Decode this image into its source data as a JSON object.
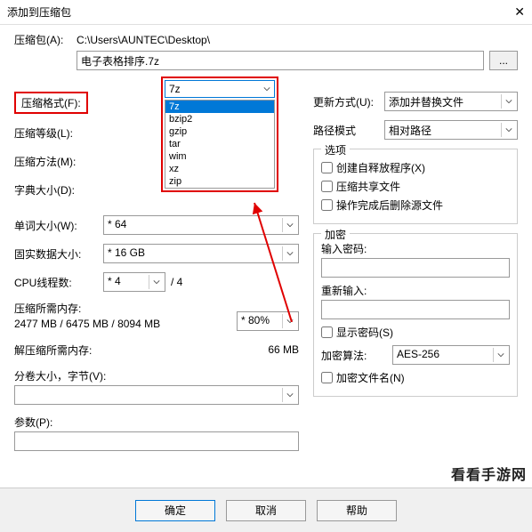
{
  "window": {
    "title": "添加到压缩包",
    "close": "✕"
  },
  "archive": {
    "label": "压缩包(A):",
    "path": "C:\\Users\\AUNTEC\\Desktop\\",
    "filename": "电子表格排序.7z",
    "browse": "..."
  },
  "left": {
    "format_label": "压缩格式(F):",
    "format_value": "7z",
    "format_options": [
      "7z",
      "bzip2",
      "gzip",
      "tar",
      "wim",
      "xz",
      "zip"
    ],
    "level_label": "压缩等级(L):",
    "method_label": "压缩方法(M):",
    "dict_label": "字典大小(D):",
    "word_label": "单词大小(W):",
    "word_value": "* 64",
    "solid_label": "固实数据大小:",
    "solid_value": "* 16 GB",
    "cpu_label": "CPU线程数:",
    "cpu_value": "* 4",
    "cpu_max": "/ 4",
    "compress_mem_label": "压缩所需内存:",
    "compress_mem_value": "2477 MB / 6475 MB / 8094 MB",
    "compress_mem_pct": "* 80%",
    "decompress_mem_label": "解压缩所需内存:",
    "decompress_mem_value": "66 MB",
    "split_label": "分卷大小，字节(V):",
    "params_label": "参数(P):"
  },
  "right": {
    "update_label": "更新方式(U):",
    "update_value": "添加并替换文件",
    "pathmode_label": "路径模式",
    "pathmode_value": "相对路径",
    "options_legend": "选项",
    "sfx_label": "创建自释放程序(X)",
    "shared_label": "压缩共享文件",
    "delete_label": "操作完成后删除源文件",
    "encrypt_legend": "加密",
    "pwd_label": "输入密码:",
    "repwd_label": "重新输入:",
    "showpwd_label": "显示密码(S)",
    "algo_label": "加密算法:",
    "algo_value": "AES-256",
    "encnames_label": "加密文件名(N)"
  },
  "buttons": {
    "ok": "确定",
    "cancel": "取消",
    "help": "帮助"
  },
  "watermark": "看看手游网"
}
